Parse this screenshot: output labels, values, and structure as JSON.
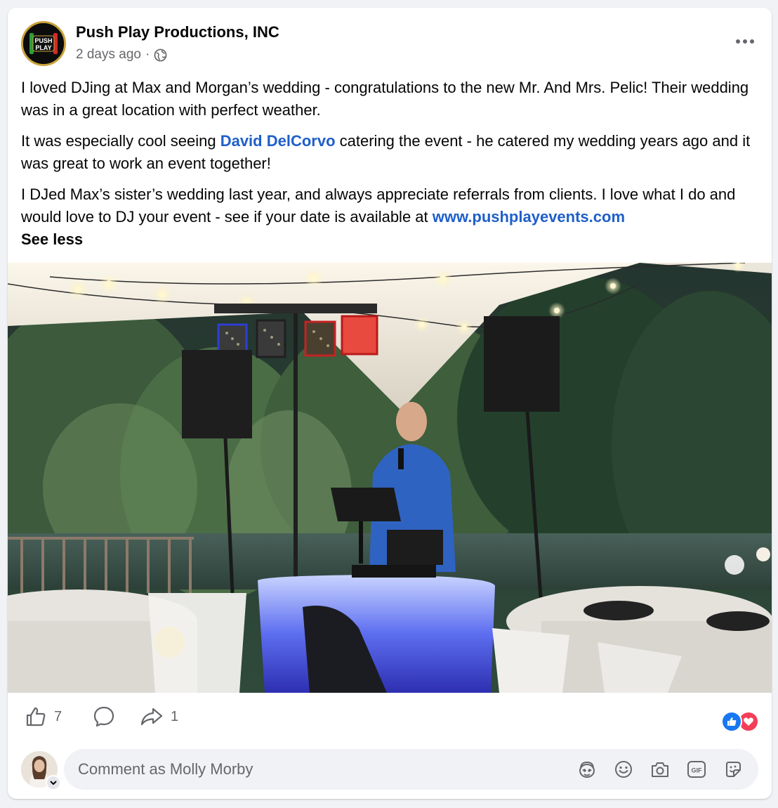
{
  "post": {
    "page_name": "Push Play Productions, INC",
    "timestamp": "2 days ago",
    "separator": "·",
    "audience_icon": "globe-icon",
    "logo_text_top": "PUSH",
    "logo_text_bottom": "PLAY",
    "paragraphs": {
      "p1": "I loved DJing at Max and Morgan’s wedding - congratulations to the new Mr. And Mrs. Pelic! Their wedding was in a great location with perfect weather.",
      "p2_before": "It was especially cool seeing ",
      "p2_link": "David DelCorvo",
      "p2_after": " catering the event - he catered my wedding years ago and it was great to work an event together!",
      "p3_before": "I DJed Max’s sister’s wedding last year, and always appreciate referrals from clients. I love what I do and would love to DJ your event - see if your date is available at ",
      "p3_link": "www.pushplayevents.com"
    },
    "see_less": "See less"
  },
  "actions": {
    "like_count": "7",
    "share_count": "1",
    "like_icon": "thumbs-up-icon",
    "comment_icon": "comment-bubble-icon",
    "share_icon": "share-arrow-icon",
    "reactions": [
      "like-reaction-icon",
      "love-reaction-icon"
    ]
  },
  "comment": {
    "placeholder": "Comment as Molly Morby",
    "tools": [
      "avatar-sticker-icon",
      "emoji-icon",
      "camera-icon",
      "gif-icon",
      "sticker-icon"
    ],
    "gif_label": "GIF"
  },
  "colors": {
    "link": "#1f5fc9",
    "secondary_text": "#65676b",
    "like_blue": "#1877f2",
    "love_red": "#f33e58"
  }
}
